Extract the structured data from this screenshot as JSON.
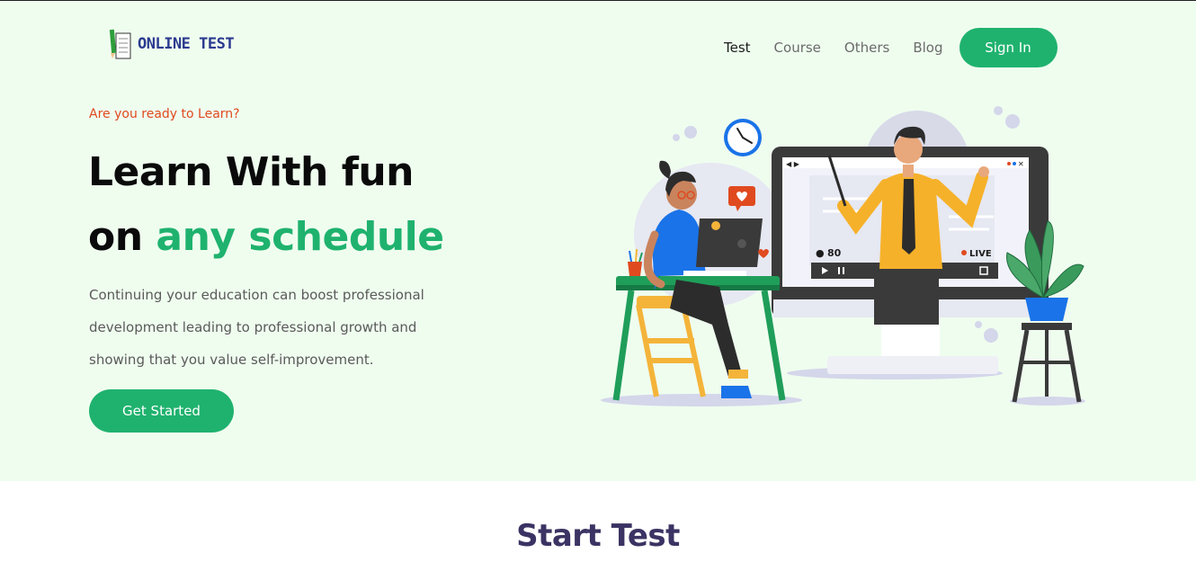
{
  "brand": {
    "name": "ONLINE TEST"
  },
  "nav": {
    "items": [
      "Test",
      "Course",
      "Others",
      "Blog"
    ],
    "active": "Test",
    "signin_label": "Sign In"
  },
  "hero": {
    "kicker": "Are you ready to Learn?",
    "headline_line1": "Learn With fun",
    "headline_line2_prefix": "on ",
    "headline_line2_accent": "any schedule",
    "description": "Continuing your education can boost professional development leading to professional growth and showing that you value self-improvement.",
    "cta_label": "Get Started",
    "illustration": {
      "viewer_count": "80",
      "live_label": "LIVE"
    }
  },
  "section": {
    "title": "Start Test"
  },
  "colors": {
    "accent": "#1fb26e",
    "hero_bg": "#effdef",
    "kicker": "#e04a1f",
    "section_title": "#3b3363"
  }
}
